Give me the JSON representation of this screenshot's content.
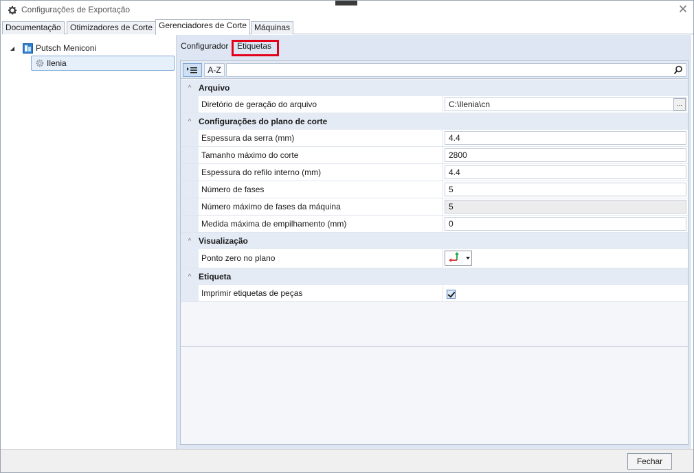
{
  "window": {
    "title": "Configurações de Exportação",
    "close_glyph": "✕"
  },
  "tabs": [
    {
      "label": "Documentação"
    },
    {
      "label": "Otimizadores de Corte"
    },
    {
      "label": "Gerenciadores de Corte",
      "active": true
    },
    {
      "label": "Máquinas"
    }
  ],
  "tree": {
    "root_label": "Putsch Meniconi",
    "child_label": "Ilenia"
  },
  "subtabs": {
    "configurador": "Configurador",
    "etiquetas": "Etiquetas"
  },
  "toolbar": {
    "categorized_icon": "categorized-icon",
    "az_label": "A-Z",
    "search_placeholder": ""
  },
  "categories": [
    {
      "title": "Arquivo",
      "rows": [
        {
          "name": "Diretório de geração do arquivo",
          "value": "C:\\Ilenia\\cn"
        }
      ]
    },
    {
      "title": "Configurações do plano de corte",
      "rows": [
        {
          "name": "Espessura da serra (mm)",
          "value": "4.4"
        },
        {
          "name": "Tamanho máximo do corte",
          "value": "2800"
        },
        {
          "name": "Espessura do refilo interno (mm)",
          "value": "4.4"
        },
        {
          "name": "Número de fases",
          "value": "5"
        },
        {
          "name": "Número máximo de fases da máquina",
          "value": "5"
        },
        {
          "name": "Medida máxima de empilhamento (mm)",
          "value": "0"
        }
      ]
    },
    {
      "title": "Visualização",
      "rows": [
        {
          "name": "Ponto zero no plano",
          "value": ""
        }
      ]
    },
    {
      "title": "Etiqueta",
      "rows": [
        {
          "name": "Imprimir etiquetas de peças",
          "checked": true
        }
      ]
    }
  ],
  "browse_label": "...",
  "footer": {
    "close_label": "Fechar"
  },
  "colors": {
    "highlight_box": "#e3001b",
    "pane_bg": "#dde6f2"
  }
}
